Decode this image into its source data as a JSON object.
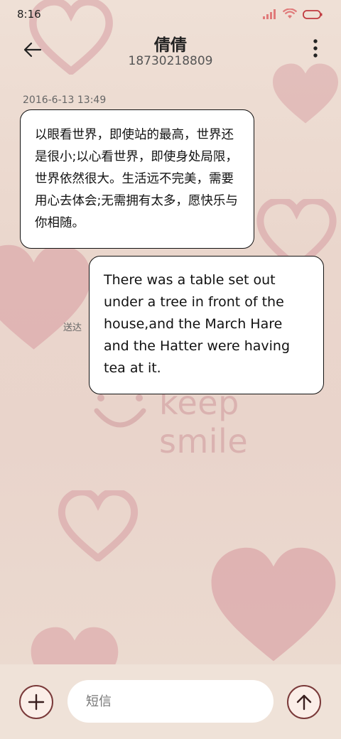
{
  "status_bar": {
    "time": "8:16"
  },
  "header": {
    "contact_name": "倩倩",
    "phone_number": "18730218809"
  },
  "conversation": {
    "timestamp": "2016-6-13 13:49",
    "incoming_message": "以眼看世界，即使站的最高，世界还是很小;以心看世界，即使身处局限，世界依然很大。生活远不完美，需要用心去体会;无需拥有太多，愿快乐与你相随。",
    "outgoing_message": "There was a table set out under a tree in front of the house,and the March Hare and the Hatter were having tea at it.",
    "delivery_status": "送达"
  },
  "background": {
    "watermark_text": "keep smile"
  },
  "composer": {
    "placeholder": "短信"
  },
  "colors": {
    "accent": "#7a3a3a",
    "background": "#ead6cc",
    "heart": "#d9a3a8"
  },
  "icons": [
    "back-arrow-icon",
    "more-vert-icon",
    "plus-icon",
    "send-arrow-icon",
    "signal-icon",
    "wifi-icon",
    "battery-icon"
  ]
}
